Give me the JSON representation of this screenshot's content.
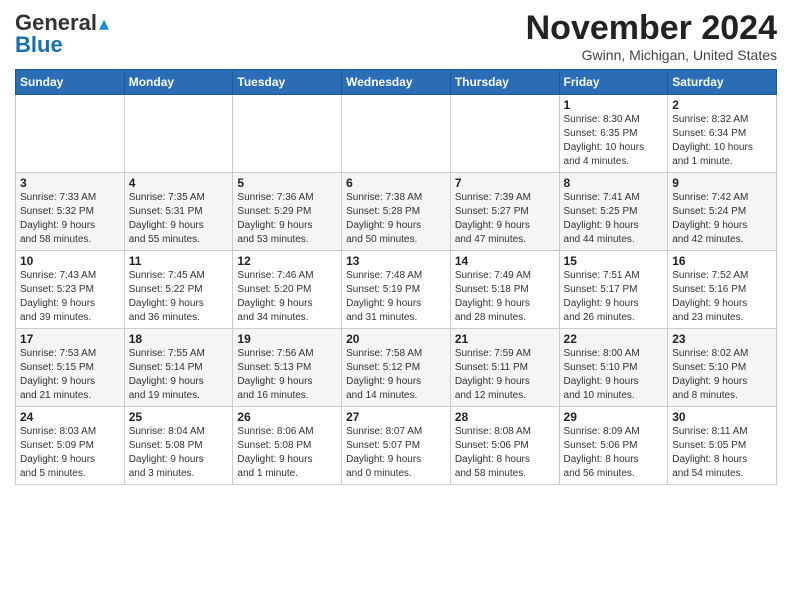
{
  "header": {
    "logo_general": "General",
    "logo_blue": "Blue",
    "month_title": "November 2024",
    "location": "Gwinn, Michigan, United States"
  },
  "days_of_week": [
    "Sunday",
    "Monday",
    "Tuesday",
    "Wednesday",
    "Thursday",
    "Friday",
    "Saturday"
  ],
  "weeks": [
    [
      {
        "day": "",
        "info": ""
      },
      {
        "day": "",
        "info": ""
      },
      {
        "day": "",
        "info": ""
      },
      {
        "day": "",
        "info": ""
      },
      {
        "day": "",
        "info": ""
      },
      {
        "day": "1",
        "info": "Sunrise: 8:30 AM\nSunset: 6:35 PM\nDaylight: 10 hours\nand 4 minutes."
      },
      {
        "day": "2",
        "info": "Sunrise: 8:32 AM\nSunset: 6:34 PM\nDaylight: 10 hours\nand 1 minute."
      }
    ],
    [
      {
        "day": "3",
        "info": "Sunrise: 7:33 AM\nSunset: 5:32 PM\nDaylight: 9 hours\nand 58 minutes."
      },
      {
        "day": "4",
        "info": "Sunrise: 7:35 AM\nSunset: 5:31 PM\nDaylight: 9 hours\nand 55 minutes."
      },
      {
        "day": "5",
        "info": "Sunrise: 7:36 AM\nSunset: 5:29 PM\nDaylight: 9 hours\nand 53 minutes."
      },
      {
        "day": "6",
        "info": "Sunrise: 7:38 AM\nSunset: 5:28 PM\nDaylight: 9 hours\nand 50 minutes."
      },
      {
        "day": "7",
        "info": "Sunrise: 7:39 AM\nSunset: 5:27 PM\nDaylight: 9 hours\nand 47 minutes."
      },
      {
        "day": "8",
        "info": "Sunrise: 7:41 AM\nSunset: 5:25 PM\nDaylight: 9 hours\nand 44 minutes."
      },
      {
        "day": "9",
        "info": "Sunrise: 7:42 AM\nSunset: 5:24 PM\nDaylight: 9 hours\nand 42 minutes."
      }
    ],
    [
      {
        "day": "10",
        "info": "Sunrise: 7:43 AM\nSunset: 5:23 PM\nDaylight: 9 hours\nand 39 minutes."
      },
      {
        "day": "11",
        "info": "Sunrise: 7:45 AM\nSunset: 5:22 PM\nDaylight: 9 hours\nand 36 minutes."
      },
      {
        "day": "12",
        "info": "Sunrise: 7:46 AM\nSunset: 5:20 PM\nDaylight: 9 hours\nand 34 minutes."
      },
      {
        "day": "13",
        "info": "Sunrise: 7:48 AM\nSunset: 5:19 PM\nDaylight: 9 hours\nand 31 minutes."
      },
      {
        "day": "14",
        "info": "Sunrise: 7:49 AM\nSunset: 5:18 PM\nDaylight: 9 hours\nand 28 minutes."
      },
      {
        "day": "15",
        "info": "Sunrise: 7:51 AM\nSunset: 5:17 PM\nDaylight: 9 hours\nand 26 minutes."
      },
      {
        "day": "16",
        "info": "Sunrise: 7:52 AM\nSunset: 5:16 PM\nDaylight: 9 hours\nand 23 minutes."
      }
    ],
    [
      {
        "day": "17",
        "info": "Sunrise: 7:53 AM\nSunset: 5:15 PM\nDaylight: 9 hours\nand 21 minutes."
      },
      {
        "day": "18",
        "info": "Sunrise: 7:55 AM\nSunset: 5:14 PM\nDaylight: 9 hours\nand 19 minutes."
      },
      {
        "day": "19",
        "info": "Sunrise: 7:56 AM\nSunset: 5:13 PM\nDaylight: 9 hours\nand 16 minutes."
      },
      {
        "day": "20",
        "info": "Sunrise: 7:58 AM\nSunset: 5:12 PM\nDaylight: 9 hours\nand 14 minutes."
      },
      {
        "day": "21",
        "info": "Sunrise: 7:59 AM\nSunset: 5:11 PM\nDaylight: 9 hours\nand 12 minutes."
      },
      {
        "day": "22",
        "info": "Sunrise: 8:00 AM\nSunset: 5:10 PM\nDaylight: 9 hours\nand 10 minutes."
      },
      {
        "day": "23",
        "info": "Sunrise: 8:02 AM\nSunset: 5:10 PM\nDaylight: 9 hours\nand 8 minutes."
      }
    ],
    [
      {
        "day": "24",
        "info": "Sunrise: 8:03 AM\nSunset: 5:09 PM\nDaylight: 9 hours\nand 5 minutes."
      },
      {
        "day": "25",
        "info": "Sunrise: 8:04 AM\nSunset: 5:08 PM\nDaylight: 9 hours\nand 3 minutes."
      },
      {
        "day": "26",
        "info": "Sunrise: 8:06 AM\nSunset: 5:08 PM\nDaylight: 9 hours\nand 1 minute."
      },
      {
        "day": "27",
        "info": "Sunrise: 8:07 AM\nSunset: 5:07 PM\nDaylight: 9 hours\nand 0 minutes."
      },
      {
        "day": "28",
        "info": "Sunrise: 8:08 AM\nSunset: 5:06 PM\nDaylight: 8 hours\nand 58 minutes."
      },
      {
        "day": "29",
        "info": "Sunrise: 8:09 AM\nSunset: 5:06 PM\nDaylight: 8 hours\nand 56 minutes."
      },
      {
        "day": "30",
        "info": "Sunrise: 8:11 AM\nSunset: 5:05 PM\nDaylight: 8 hours\nand 54 minutes."
      }
    ]
  ]
}
